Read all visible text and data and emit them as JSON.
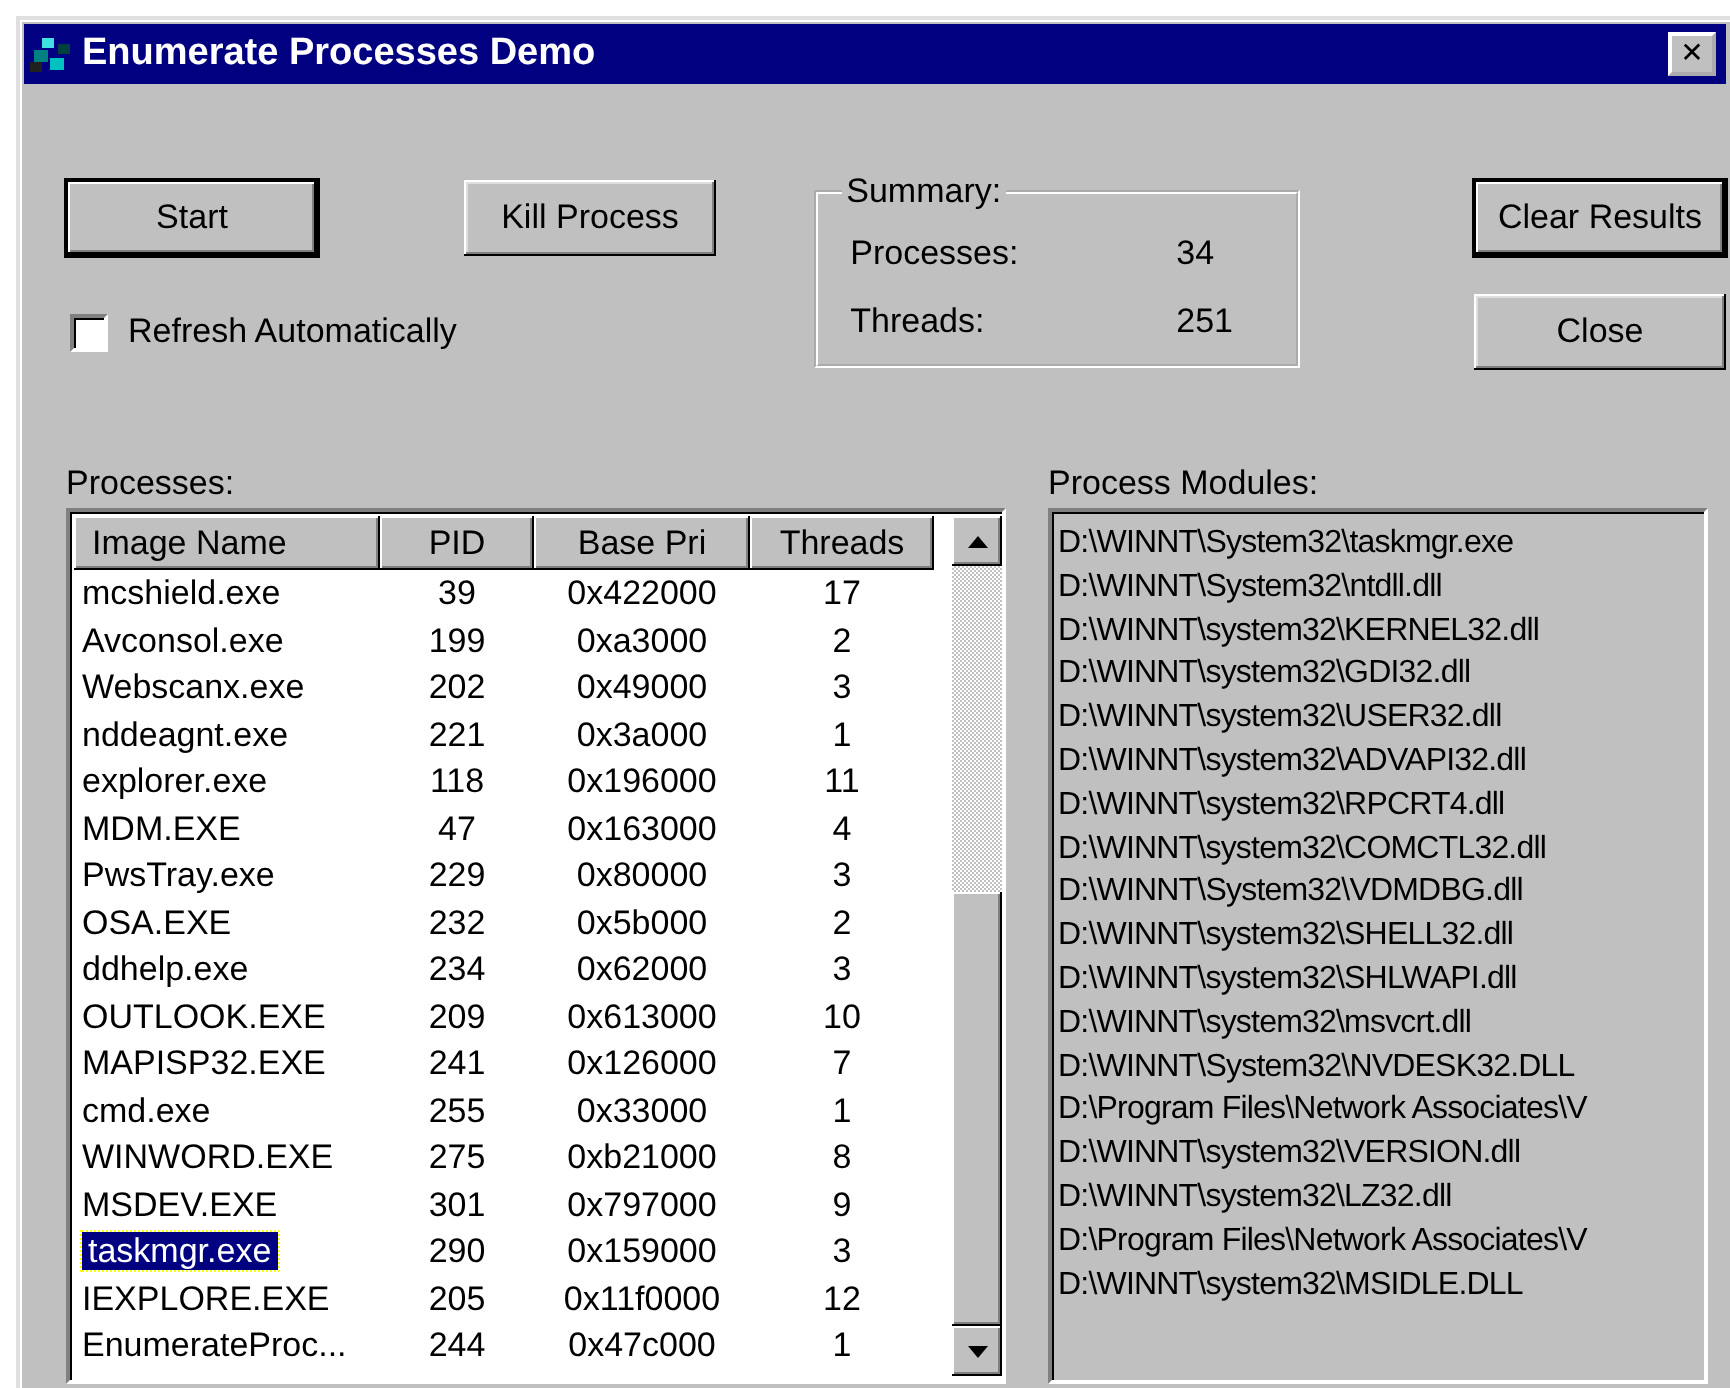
{
  "window": {
    "title": "Enumerate Processes Demo",
    "close_glyph": "✕"
  },
  "start_button": {
    "label": "Start",
    "default": true
  },
  "kill_button": {
    "label": "Kill Process",
    "default": false
  },
  "refresh_checkbox": {
    "label": "Refresh Automatically",
    "checked": false
  },
  "summary": {
    "title": "Summary:",
    "rows": [
      {
        "label": "Processes:",
        "value": "34"
      },
      {
        "label": "Threads:",
        "value": "251"
      }
    ]
  },
  "clear_button": {
    "label": "Clear Results",
    "default": true
  },
  "close_button": {
    "label": "Close",
    "default": false
  },
  "processes": {
    "label": "Processes:",
    "columns": [
      "Image Name",
      "PID",
      "Base Pri",
      "Threads"
    ],
    "rows": [
      {
        "cells": [
          "mcshield.exe",
          "39",
          "0x422000",
          "17"
        ],
        "selected": false
      },
      {
        "cells": [
          "Avconsol.exe",
          "199",
          "0xa3000",
          "2"
        ],
        "selected": false
      },
      {
        "cells": [
          "Webscanx.exe",
          "202",
          "0x49000",
          "3"
        ],
        "selected": false
      },
      {
        "cells": [
          "nddeagnt.exe",
          "221",
          "0x3a000",
          "1"
        ],
        "selected": false
      },
      {
        "cells": [
          "explorer.exe",
          "118",
          "0x196000",
          "11"
        ],
        "selected": false
      },
      {
        "cells": [
          "MDM.EXE",
          "47",
          "0x163000",
          "4"
        ],
        "selected": false
      },
      {
        "cells": [
          "PwsTray.exe",
          "229",
          "0x80000",
          "3"
        ],
        "selected": false
      },
      {
        "cells": [
          "OSA.EXE",
          "232",
          "0x5b000",
          "2"
        ],
        "selected": false
      },
      {
        "cells": [
          "ddhelp.exe",
          "234",
          "0x62000",
          "3"
        ],
        "selected": false
      },
      {
        "cells": [
          "OUTLOOK.EXE",
          "209",
          "0x613000",
          "10"
        ],
        "selected": false
      },
      {
        "cells": [
          "MAPISP32.EXE",
          "241",
          "0x126000",
          "7"
        ],
        "selected": false
      },
      {
        "cells": [
          "cmd.exe",
          "255",
          "0x33000",
          "1"
        ],
        "selected": false
      },
      {
        "cells": [
          "WINWORD.EXE",
          "275",
          "0xb21000",
          "8"
        ],
        "selected": false
      },
      {
        "cells": [
          "MSDEV.EXE",
          "301",
          "0x797000",
          "9"
        ],
        "selected": false
      },
      {
        "cells": [
          "taskmgr.exe",
          "290",
          "0x159000",
          "3"
        ],
        "selected": true
      },
      {
        "cells": [
          "IEXPLORE.EXE",
          "205",
          "0x11f0000",
          "12"
        ],
        "selected": false
      },
      {
        "cells": [
          "EnumerateProc...",
          "244",
          "0x47c000",
          "1"
        ],
        "selected": false
      }
    ]
  },
  "modules": {
    "label": "Process Modules:",
    "items": [
      "D:\\WINNT\\System32\\taskmgr.exe",
      "D:\\WINNT\\System32\\ntdll.dll",
      "D:\\WINNT\\system32\\KERNEL32.dll",
      "D:\\WINNT\\system32\\GDI32.dll",
      "D:\\WINNT\\system32\\USER32.dll",
      "D:\\WINNT\\system32\\ADVAPI32.dll",
      "D:\\WINNT\\system32\\RPCRT4.dll",
      "D:\\WINNT\\system32\\COMCTL32.dll",
      "D:\\WINNT\\System32\\VDMDBG.dll",
      "D:\\WINNT\\system32\\SHELL32.dll",
      "D:\\WINNT\\system32\\SHLWAPI.dll",
      "D:\\WINNT\\system32\\msvcrt.dll",
      "D:\\WINNT\\System32\\NVDESK32.DLL",
      "D:\\Program Files\\Network Associates\\V",
      "D:\\WINNT\\system32\\VERSION.dll",
      "D:\\WINNT\\system32\\LZ32.dll",
      "D:\\Program Files\\Network Associates\\V",
      "D:\\WINNT\\system32\\MSIDLE.DLL"
    ]
  }
}
